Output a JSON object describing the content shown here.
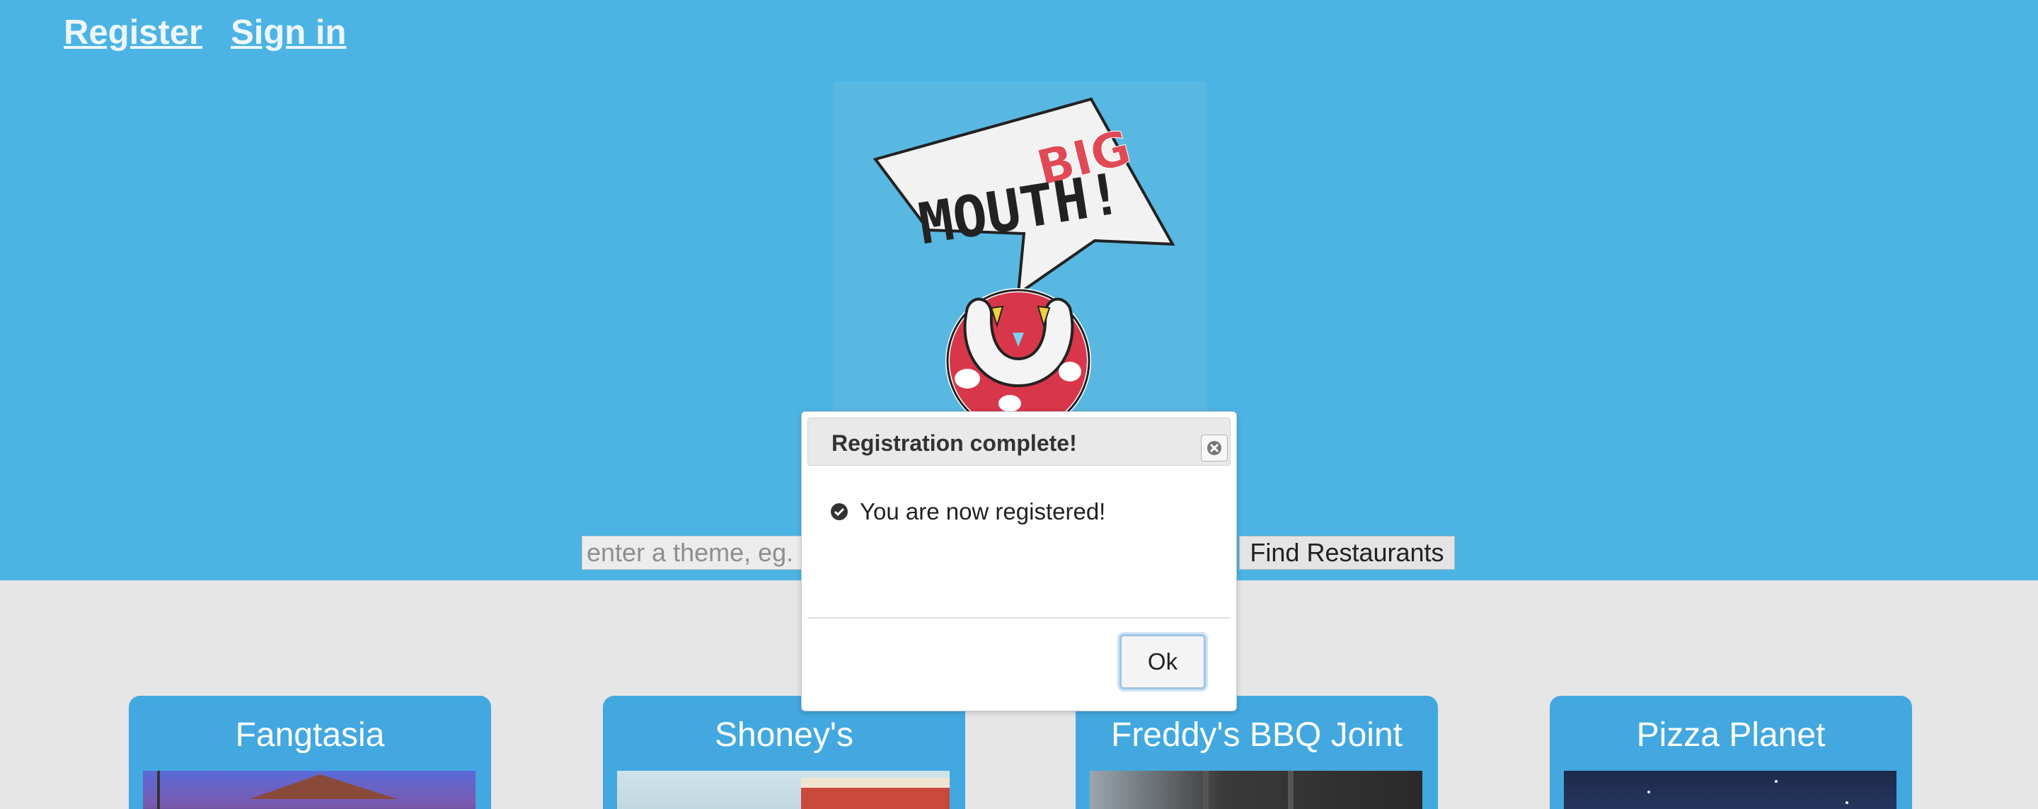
{
  "nav": {
    "register": "Register",
    "sign_in": "Sign in"
  },
  "logo": {
    "word_big": "BIG",
    "word_mouth": "MOUTH!"
  },
  "search": {
    "placeholder": "enter a theme, eg.",
    "button": "Find Restaurants"
  },
  "restaurants": [
    {
      "name": "Fangtasia"
    },
    {
      "name": "Shoney's"
    },
    {
      "name": "Freddy's BBQ Joint"
    },
    {
      "name": "Pizza Planet"
    }
  ],
  "dialog": {
    "title": "Registration complete!",
    "message": "You are now registered!",
    "ok": "Ok"
  },
  "colors": {
    "hero": "#4bb4e4",
    "card": "#42a8df",
    "page": "#e6e6e6"
  },
  "icons": {
    "close": "close-icon",
    "check": "check-circle-icon"
  }
}
